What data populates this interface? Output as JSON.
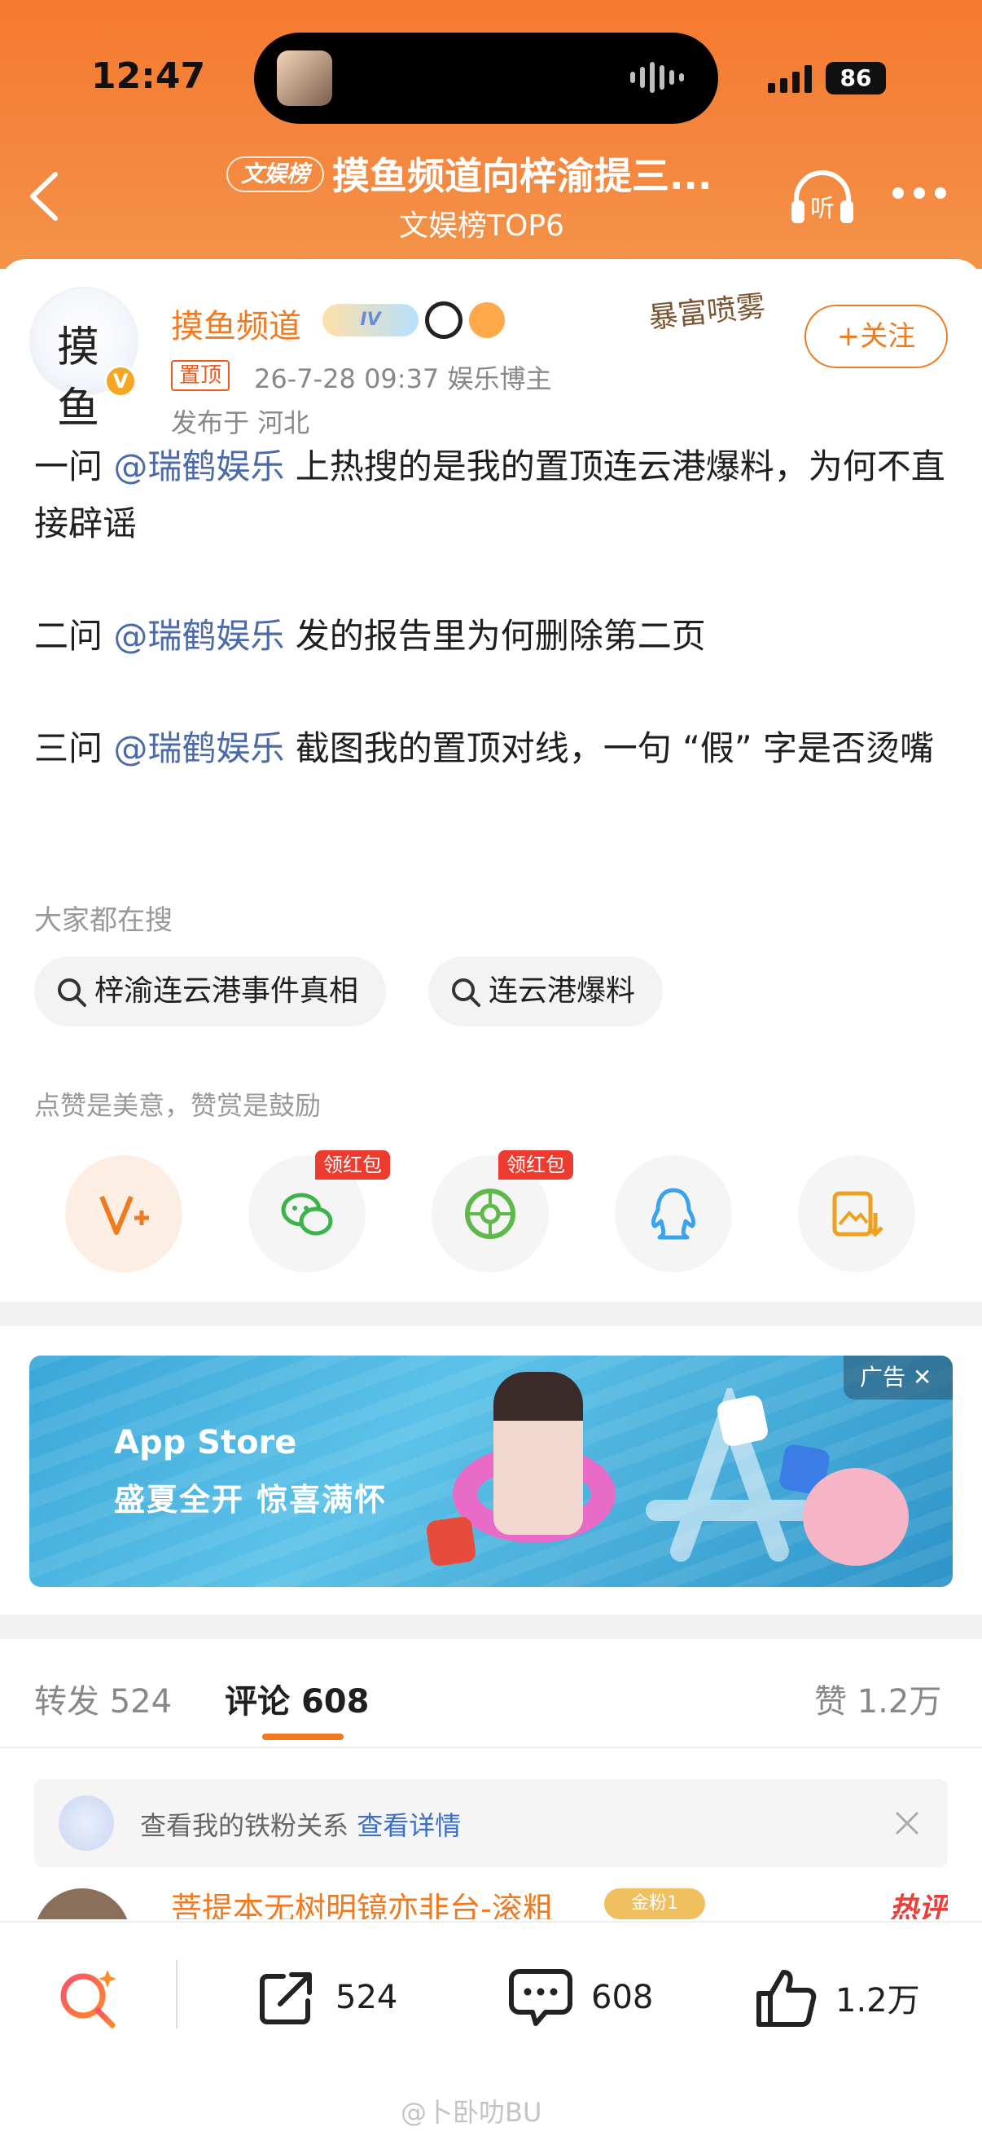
{
  "status_bar": {
    "time": "12:47",
    "battery": "86"
  },
  "nav": {
    "rank_badge": "文娱榜",
    "title": "摸鱼频道向梓渝提三...",
    "subtitle": "文娱榜TOP6",
    "listen_label": "听"
  },
  "post": {
    "author": "摸鱼频道",
    "avatar_text": "摸鱼",
    "name_badge": "IV",
    "verified_badge": "V",
    "pin_tag": "置顶",
    "meta": "26-7-28 09:37  娱乐博主",
    "location": "发布于 河北",
    "decor_text": "暴富喷雾",
    "follow_label": "+关注",
    "paragraphs": [
      {
        "prefix": "一问 ",
        "mention": "@瑞鹤娱乐",
        "suffix": " 上热搜的是我的置顶连云港爆料，为何不直接辟谣"
      },
      {
        "prefix": "二问 ",
        "mention": "@瑞鹤娱乐",
        "suffix": " 发的报告里为何删除第二页"
      },
      {
        "prefix": "三问 ",
        "mention": "@瑞鹤娱乐",
        "suffix": " 截图我的置顶对线，一句 “假” 字是否烫嘴"
      }
    ],
    "search_hint": "大家都在搜",
    "search_chips": [
      "梓渝连云港事件真相",
      "连云港爆料"
    ],
    "reward_tip": "点赞是美意，赞赏是鼓励",
    "share_items": [
      {
        "icon": "reward-icon",
        "badge": ""
      },
      {
        "icon": "wechat-icon",
        "badge": "领红包"
      },
      {
        "icon": "moments-icon",
        "badge": "领红包"
      },
      {
        "icon": "qq-icon",
        "badge": ""
      },
      {
        "icon": "save-image-icon",
        "badge": ""
      }
    ]
  },
  "ad": {
    "brand": "App Store",
    "slogan": "盛夏全开 惊喜满怀",
    "label": "广告"
  },
  "tabs": {
    "repost_label": "转发",
    "repost_count": "524",
    "comment_label": "评论",
    "comment_count": "608",
    "like_label": "赞",
    "like_count": "1.2万"
  },
  "fan_banner": {
    "text": "查看我的铁粉关系",
    "link": "查看详情"
  },
  "comment_peek": {
    "name": "菩提本无树明镜亦非台-滚粗",
    "badge": "金粉1",
    "hot": "热评"
  },
  "bottom_bar": {
    "repost": "524",
    "comment": "608",
    "like": "1.2万"
  },
  "watermark": "@卜卧叻BU",
  "colors": {
    "header": "#f57a2f",
    "accent": "#f07a20",
    "mention": "#4c6aa7",
    "redpack": "#ee3b2f"
  }
}
